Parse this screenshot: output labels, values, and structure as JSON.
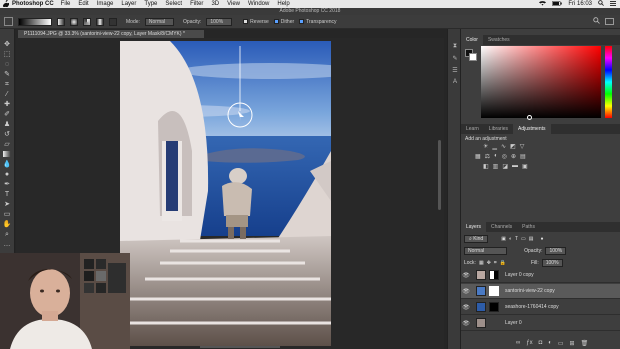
{
  "menubar": {
    "apple": "",
    "app_name": "Photoshop CC",
    "items": [
      "File",
      "Edit",
      "Image",
      "Layer",
      "Type",
      "Select",
      "Filter",
      "3D",
      "View",
      "Window",
      "Help"
    ],
    "clock": "Fri 16:03"
  },
  "window_title": "Adobe Photoshop CC 2018",
  "options_bar": {
    "mode_label": "Mode:",
    "mode_value": "Normal",
    "opacity_label": "Opacity:",
    "opacity_value": "100%",
    "reverse_label": "Reverse",
    "dither_label": "Dither",
    "transparency_label": "Transparency"
  },
  "document_tab": "P1111094.JPG @ 33.3% (santorini-view-22 copy, Layer Mask/8/CMYK) *",
  "color_panel": {
    "tabs": [
      "Color",
      "Swatches"
    ],
    "active_tab": "Color"
  },
  "adjustments_panel": {
    "tabs": [
      "Learn",
      "Libraries",
      "Adjustments"
    ],
    "active_tab": "Adjustments",
    "heading": "Add an adjustment"
  },
  "layers_panel": {
    "tabs": [
      "Layers",
      "Channels",
      "Paths"
    ],
    "active_tab": "Layers",
    "filter_label": "Kind",
    "blend_mode": "Normal",
    "opacity_label": "Opacity:",
    "opacity_value": "100%",
    "lock_label": "Lock:",
    "fill_label": "Fill:",
    "fill_value": "100%",
    "layers": [
      {
        "name": "Layer 0 copy",
        "selected": false
      },
      {
        "name": "santorini-view-22 copy",
        "selected": true
      },
      {
        "name": "seashore-1760414 copy",
        "selected": false
      },
      {
        "name": "Layer 0",
        "selected": false
      }
    ],
    "footer_icons": [
      "link-icon",
      "fx-icon",
      "mask-icon",
      "adjustment-icon",
      "folder-icon",
      "new-layer-icon",
      "trash-icon"
    ]
  },
  "colors": {
    "accent": "#5aa0ff",
    "panel_bg": "#3e3e3e",
    "sky": "#3d78c8",
    "sea": "#1f4fa0"
  }
}
